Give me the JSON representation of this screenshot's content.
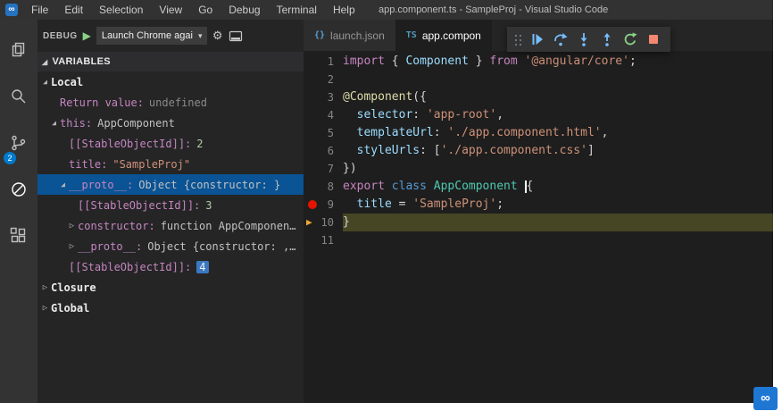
{
  "titlebar": {
    "menus": [
      "File",
      "Edit",
      "Selection",
      "View",
      "Go",
      "Debug",
      "Terminal",
      "Help"
    ],
    "title": "app.component.ts - SampleProj - Visual Studio Code"
  },
  "activity_bar": {
    "badge": "2",
    "items": [
      "explorer",
      "search",
      "source-control",
      "debug",
      "extensions"
    ],
    "active_item": "debug"
  },
  "glyphs": {
    "logo": "∞",
    "expanded": "◢",
    "collapsed": "▷",
    "dropdown_chevron": "▾",
    "play": "▶",
    "gear": "⚙"
  },
  "debug_panel": {
    "label": "DEBUG",
    "config_name": "Launch Chrome agai",
    "variables_header": "VARIABLES",
    "variables": [
      {
        "indent": 1,
        "arrow": "expanded",
        "name": "Local",
        "nameClass": "scope"
      },
      {
        "indent": 2,
        "arrow": "none",
        "name": "Return value:",
        "value": "undefined",
        "valueClass": "undef"
      },
      {
        "indent": 2,
        "arrow": "expanded",
        "name": "this:",
        "value": "AppComponent",
        "valueClass": "obj"
      },
      {
        "indent": 3,
        "arrow": "none",
        "name": "[[StableObjectId]]:",
        "value": "2",
        "valueClass": "num"
      },
      {
        "indent": 3,
        "arrow": "none",
        "name": "title:",
        "value": "\"SampleProj\"",
        "valueClass": "str"
      },
      {
        "indent": 3,
        "arrow": "expanded",
        "name": "__proto__:",
        "value": "Object {constructor: }",
        "valueClass": "obj",
        "selected": true
      },
      {
        "indent": 4,
        "arrow": "none",
        "name": "[[StableObjectId]]:",
        "value": "3",
        "valueClass": "num"
      },
      {
        "indent": 4,
        "arrow": "collapsed",
        "name": "constructor:",
        "value": "function AppComponen…",
        "valueClass": "obj"
      },
      {
        "indent": 4,
        "arrow": "collapsed",
        "name": "__proto__:",
        "value": "Object {constructor: ,…",
        "valueClass": "obj"
      },
      {
        "indent": 3,
        "arrow": "none",
        "name": "[[StableObjectId]]:",
        "value": "4",
        "valueClass": "num",
        "changed": true
      },
      {
        "indent": 1,
        "arrow": "collapsed",
        "name": "Closure",
        "nameClass": "scope"
      },
      {
        "indent": 1,
        "arrow": "collapsed",
        "name": "Global",
        "nameClass": "scope"
      }
    ]
  },
  "debug_toolbar": {
    "buttons": [
      "continue",
      "step-over",
      "step-into",
      "step-out",
      "restart",
      "stop"
    ],
    "colors": {
      "step": "#75beff",
      "restart": "#89d185",
      "stop": "#f48771"
    }
  },
  "editor": {
    "tabs": [
      {
        "icon": "{}",
        "label": "launch.json",
        "active": false
      },
      {
        "icon": "TS",
        "label": "app.compon",
        "active": true
      }
    ],
    "code": [
      {
        "n": 1,
        "tokens": [
          [
            "kw",
            "import"
          ],
          [
            "pl",
            " { "
          ],
          [
            "id",
            "Component"
          ],
          [
            "pl",
            " } "
          ],
          [
            "kw",
            "from"
          ],
          [
            "pl",
            " "
          ],
          [
            "str",
            "'@angular/core'"
          ],
          [
            "pl",
            ";"
          ]
        ]
      },
      {
        "n": 2,
        "tokens": []
      },
      {
        "n": 3,
        "tokens": [
          [
            "dec",
            "@Component"
          ],
          [
            "pl",
            "({"
          ]
        ]
      },
      {
        "n": 4,
        "tokens": [
          [
            "pl",
            "  "
          ],
          [
            "id",
            "selector"
          ],
          [
            "pl",
            ": "
          ],
          [
            "str",
            "'app-root'"
          ],
          [
            "pl",
            ","
          ]
        ]
      },
      {
        "n": 5,
        "tokens": [
          [
            "pl",
            "  "
          ],
          [
            "id",
            "templateUrl"
          ],
          [
            "pl",
            ": "
          ],
          [
            "str",
            "'./app.component.html'"
          ],
          [
            "pl",
            ","
          ]
        ]
      },
      {
        "n": 6,
        "tokens": [
          [
            "pl",
            "  "
          ],
          [
            "id",
            "styleUrls"
          ],
          [
            "pl",
            ": ["
          ],
          [
            "str",
            "'./app.component.css'"
          ],
          [
            "pl",
            "]"
          ]
        ]
      },
      {
        "n": 7,
        "tokens": [
          [
            "pl",
            "})"
          ]
        ]
      },
      {
        "n": 8,
        "tokens": [
          [
            "kw",
            "export"
          ],
          [
            "pl",
            " "
          ],
          [
            "kw2",
            "class"
          ],
          [
            "pl",
            " "
          ],
          [
            "cls",
            "AppComponent"
          ],
          [
            "pl",
            " "
          ],
          [
            "cursor",
            ""
          ],
          [
            "pl",
            "{"
          ]
        ]
      },
      {
        "n": 9,
        "tokens": [
          [
            "pl",
            "  "
          ],
          [
            "id",
            "title"
          ],
          [
            "pl",
            " = "
          ],
          [
            "str",
            "'SampleProj'"
          ],
          [
            "pl",
            ";"
          ]
        ],
        "breakpoint": true
      },
      {
        "n": 10,
        "tokens": [
          [
            "pl",
            "}"
          ]
        ],
        "current": true
      },
      {
        "n": 11,
        "tokens": []
      }
    ]
  }
}
